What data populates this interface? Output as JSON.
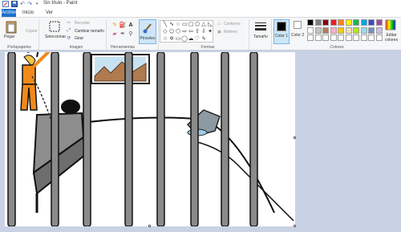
{
  "window": {
    "title": "Sin título - Paint"
  },
  "tabs": [
    {
      "label": "Archivo",
      "active": true
    },
    {
      "label": "Inicio"
    },
    {
      "label": "Ver"
    }
  ],
  "ribbon": {
    "portapapeles": {
      "label": "Portapapeles",
      "pegar": "Pegar",
      "copiar": "Copiar"
    },
    "imagen": {
      "label": "Imagen",
      "seleccionar": "Seleccionar",
      "recortar": "Recortar",
      "cambiar_tamano": "Cambiar tamaño",
      "girar": "Girar"
    },
    "herramientas": {
      "label": "Herramientas"
    },
    "pinceles": {
      "label": "Pinceles"
    },
    "formas": {
      "label": "Formas",
      "contorno": "Contorno",
      "relleno": "Relleno"
    },
    "tamano": {
      "label": "Tamaño"
    },
    "colores": {
      "label": "Colores",
      "color1": "Color 1",
      "color2": "Color 2",
      "editar": "Editar colores",
      "color1_value": "#000000",
      "color2_value": "#ffffff",
      "palette": [
        "#000000",
        "#7f7f7f",
        "#880015",
        "#ed1c24",
        "#ff7f27",
        "#fff200",
        "#22b14c",
        "#00a2e8",
        "#3f48cc",
        "#a349a4",
        "#ffffff",
        "#c3c3c3",
        "#b97a57",
        "#ffaec9",
        "#ffc90e",
        "#efe4b0",
        "#b5e61d",
        "#99d9ea",
        "#7092be",
        "#c8bfe7",
        "#ffffff",
        "#ffffff",
        "#ffffff",
        "#ffffff",
        "#ffffff",
        "#ffffff",
        "#ffffff",
        "#ffffff",
        "#ffffff",
        "#ffffff"
      ]
    }
  },
  "canvas": {
    "background": "#ffffff"
  }
}
